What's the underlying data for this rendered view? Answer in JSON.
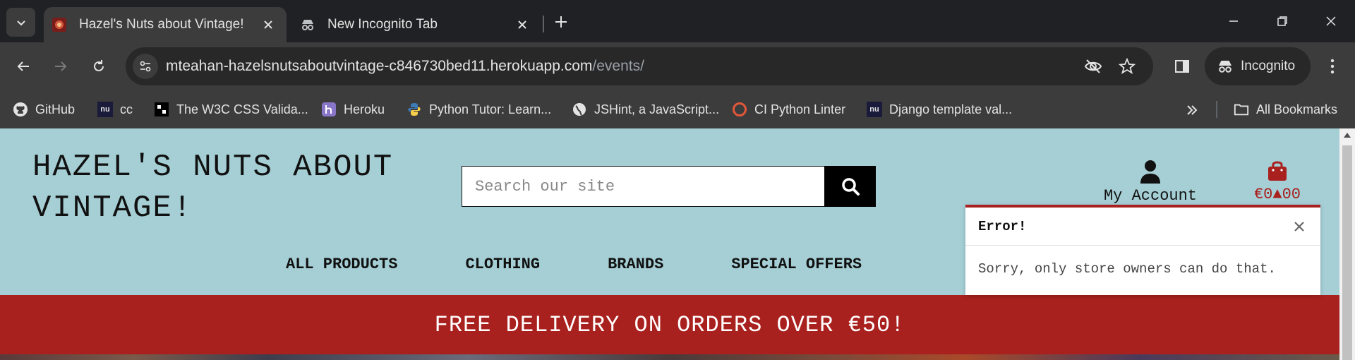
{
  "browser": {
    "tabs": [
      {
        "title": "Hazel's Nuts about Vintage!",
        "active": true
      },
      {
        "title": "New Incognito Tab",
        "active": false
      }
    ],
    "url_host": "mteahan-hazelsnutsaboutvintage-c846730bed11.herokuapp.com",
    "url_path": "/events/",
    "profile_label": "Incognito",
    "bookmarks": [
      {
        "label": "GitHub",
        "icon": "github-icon"
      },
      {
        "label": "cc",
        "icon": "nu-icon"
      },
      {
        "label": "The W3C CSS Valida...",
        "icon": "w3c-icon"
      },
      {
        "label": "Heroku",
        "icon": "heroku-icon"
      },
      {
        "label": "Python Tutor: Learn...",
        "icon": "python-icon"
      },
      {
        "label": "JSHint, a JavaScript...",
        "icon": "globe-icon"
      },
      {
        "label": "CI Python Linter",
        "icon": "ci-icon"
      },
      {
        "label": "Django template val...",
        "icon": "nu-icon"
      }
    ],
    "all_bookmarks_label": "All Bookmarks",
    "colors": {
      "chrome_bg": "#202124",
      "toolbar_bg": "#3c3c3c"
    }
  },
  "site": {
    "brand": "HAZEL'S NUTS ABOUT VINTAGE!",
    "search_placeholder": "Search our site",
    "account_label": "My Account",
    "bag_total": "€0▲00",
    "nav": [
      "ALL PRODUCTS",
      "CLOTHING",
      "BRANDS",
      "SPECIAL OFFERS"
    ],
    "banner": "FREE DELIVERY ON ORDERS OVER €50!",
    "colors": {
      "page_bg": "#a5cfd5",
      "accent": "#a9211e"
    }
  },
  "toast": {
    "title": "Error!",
    "message": "Sorry, only store owners can do that."
  }
}
